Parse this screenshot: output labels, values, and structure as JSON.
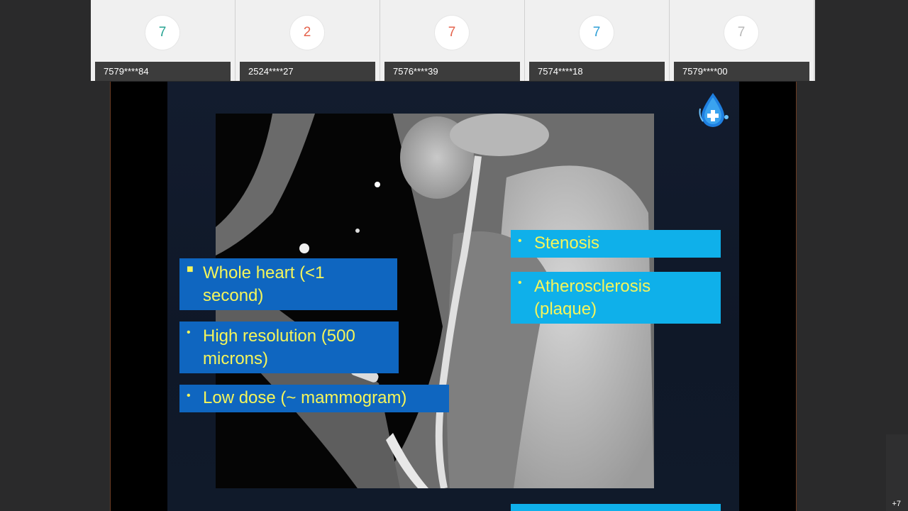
{
  "participants": [
    {
      "badge": "7",
      "badge_color": "#27a392",
      "name": "7579****84"
    },
    {
      "badge": "2",
      "badge_color": "#e5634c",
      "name": "2524****27"
    },
    {
      "badge": "7",
      "badge_color": "#e5634c",
      "name": "7576****39"
    },
    {
      "badge": "7",
      "badge_color": "#2f9fd6",
      "name": "7574****18"
    },
    {
      "badge": "7",
      "badge_color": "#b8b8b8",
      "name": "7579****00"
    }
  ],
  "slide": {
    "left_bullets": [
      {
        "marker": "■",
        "text": "Whole heart (<1 second)"
      },
      {
        "marker": "•",
        "text": "High resolution (500 microns)"
      },
      {
        "marker": "•",
        "text": "Low dose (~ mammogram)"
      }
    ],
    "right_bullets": [
      {
        "marker": "•",
        "text": "Stenosis"
      },
      {
        "marker": "•",
        "text": "Atherosclerosis (plaque)"
      }
    ],
    "logo_icon": "blood-drop-cross-icon"
  },
  "overflow_count": "+7",
  "colors": {
    "bullet_text": "#f5f55a",
    "box_dark": "#0f66c0",
    "box_cyan": "#0fb0ea"
  }
}
